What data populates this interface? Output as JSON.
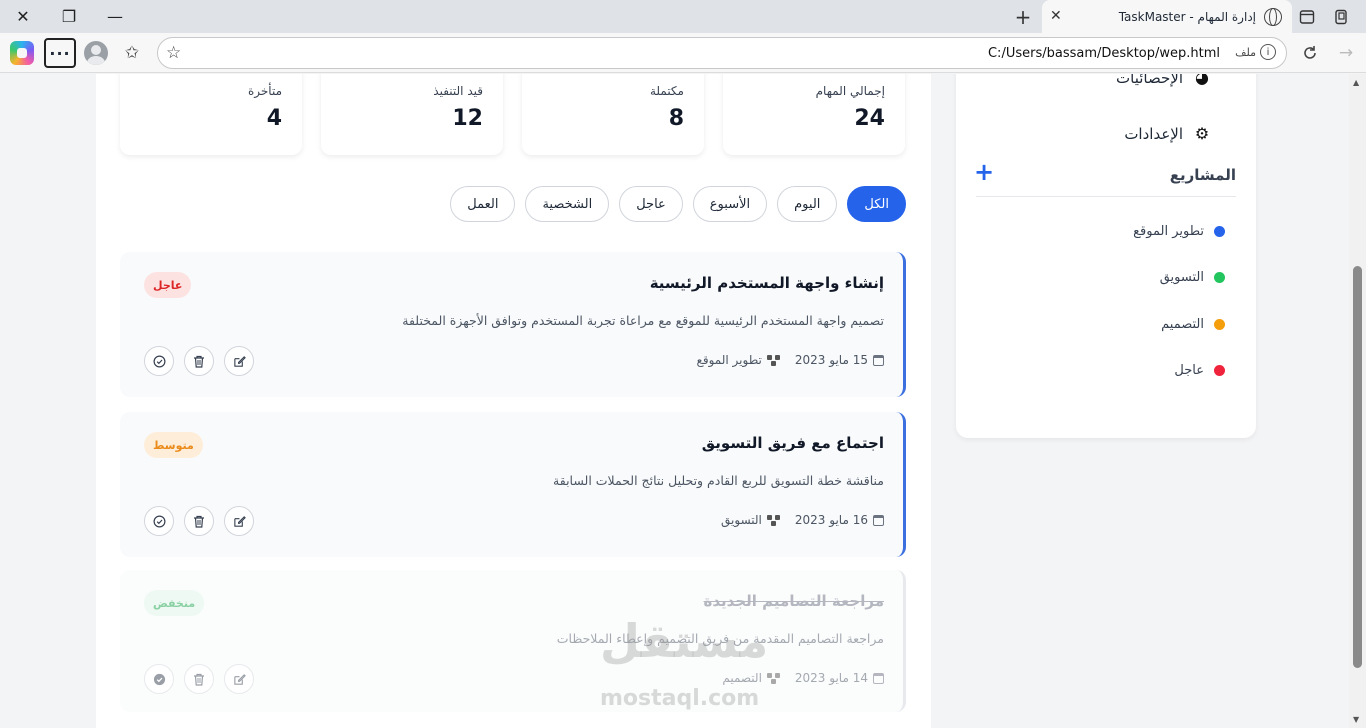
{
  "browser": {
    "tab_title": "إدارة المهام - TaskMaster",
    "url": "C:/Users/bassam/Desktop/wep.html",
    "file_label": "ملف",
    "file_info_icon": "i"
  },
  "stats": [
    {
      "label": "إجمالي المهام",
      "value": "24"
    },
    {
      "label": "مكتملة",
      "value": "8"
    },
    {
      "label": "قيد التنفيذ",
      "value": "12"
    },
    {
      "label": "متأخرة",
      "value": "4"
    }
  ],
  "filters": [
    "الكل",
    "اليوم",
    "الأسبوع",
    "عاجل",
    "الشخصية",
    "العمل"
  ],
  "active_filter": "الكل",
  "tasks": [
    {
      "title": "إنشاء واجهة المستخدم الرئيسية",
      "description": "تصميم واجهة المستخدم الرئيسية للموقع مع مراعاة تجربة المستخدم وتوافق الأجهزة المختلفة",
      "date": "15 مايو 2023",
      "project": "تطوير الموقع",
      "priority": "عاجل",
      "completed": false
    },
    {
      "title": "اجتماع مع فريق التسويق",
      "description": "مناقشة خطة التسويق للربع القادم وتحليل نتائج الحملات السابقة",
      "date": "16 مايو 2023",
      "project": "التسويق",
      "priority": "متوسط",
      "completed": false
    },
    {
      "title": "مراجعة التصاميم الجديدة",
      "description": "مراجعة التصاميم المقدمة من فريق التصميم وإعطاء الملاحظات",
      "date": "14 مايو 2023",
      "project": "التصميم",
      "priority": "منخفض",
      "completed": true
    }
  ],
  "sidebar": {
    "nav": [
      {
        "label": "الإحصائيات",
        "icon": "pie-chart-icon"
      },
      {
        "label": "الإعدادات",
        "icon": "gear-icon"
      }
    ],
    "projects_title": "المشاريع",
    "add_project": "+",
    "projects": [
      {
        "name": "تطوير الموقع",
        "color": "#2563eb"
      },
      {
        "name": "التسويق",
        "color": "#22c55e"
      },
      {
        "name": "التصميم",
        "color": "#f59e0b"
      },
      {
        "name": "عاجل",
        "color": "#ef233c"
      }
    ]
  },
  "watermark": {
    "ar": "مستقل",
    "en": "mostaql.com"
  },
  "colors": {
    "primary": "#2563eb",
    "urgent": "#dc2626",
    "medium": "#ea8a1a",
    "low": "#16a34a"
  }
}
